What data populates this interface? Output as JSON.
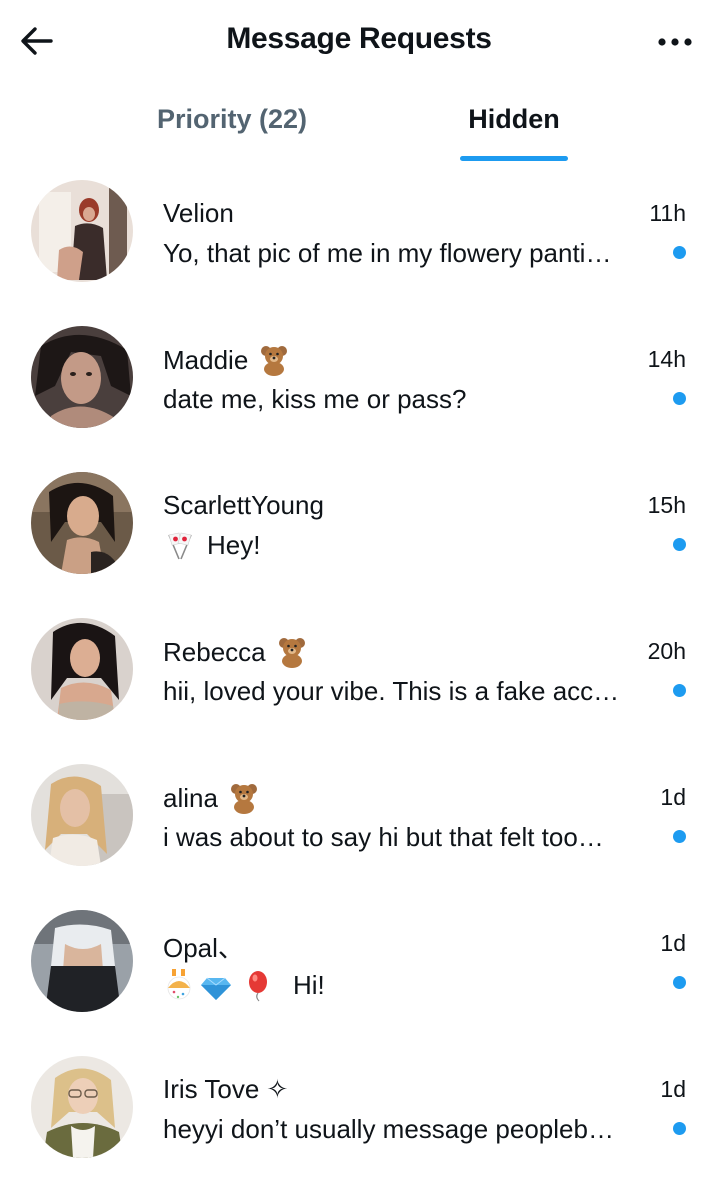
{
  "header": {
    "title": "Message Requests",
    "back_icon": "arrow-left-icon",
    "more_icon": "more-horizontal-icon"
  },
  "tabs": [
    {
      "label": "Priority (22)",
      "active": false
    },
    {
      "label": "Hidden",
      "active": true
    }
  ],
  "colors": {
    "accent": "#1d9bf0",
    "text_primary": "#0f1419",
    "text_secondary": "#536471"
  },
  "conversations": [
    {
      "name": "Velion",
      "name_emoji": "",
      "time": "11h",
      "preview": "Yo, that pic of me in my flowery panti…",
      "unread": true
    },
    {
      "name": "Maddie",
      "name_emoji": "teddy-bear-emoji",
      "time": "14h",
      "preview": "date me, kiss me or pass?",
      "unread": true
    },
    {
      "name": "ScarlettYoung",
      "name_emoji": "",
      "time": "15h",
      "preview": "Hey!",
      "preview_emoji": "japanese-flags-emoji",
      "unread": true
    },
    {
      "name": "Rebecca",
      "name_emoji": "teddy-bear-emoji",
      "time": "20h",
      "preview": "hii, loved your vibe. This is a fake acc…",
      "unread": true
    },
    {
      "name": "alina",
      "name_emoji": "teddy-bear-emoji",
      "time": "1d",
      "preview": "i was about to say hi but that felt too…",
      "unread": true
    },
    {
      "name": "Opal、",
      "name_emoji": "",
      "time": "1d",
      "preview": "Hi!",
      "preview_emoji": "confetti-diamond-balloon-emoji",
      "unread": true
    },
    {
      "name": "Iris Tove ✧",
      "name_emoji": "",
      "time": "1d",
      "preview": "heyyi don’t usually message peopleb…",
      "unread": true
    }
  ]
}
